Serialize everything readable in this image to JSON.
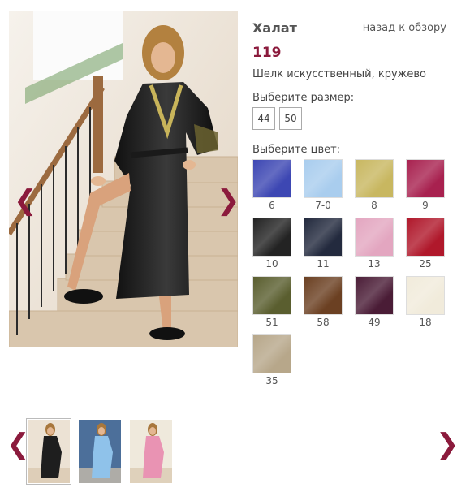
{
  "product": {
    "title": "Халат",
    "back_link": "назад к обзору",
    "price": "119",
    "material": "Шелк искусственный, кружево"
  },
  "sizes": {
    "label": "Выберите размер:",
    "options": [
      "44",
      "50"
    ]
  },
  "colors": {
    "label": "Выберите цвет:",
    "swatches": [
      {
        "code": "6",
        "color": "#3d47b3"
      },
      {
        "code": "7-0",
        "color": "#a9cdee"
      },
      {
        "code": "8",
        "color": "#c8b760"
      },
      {
        "code": "9",
        "color": "#a8214f"
      },
      {
        "code": "10",
        "color": "#232323"
      },
      {
        "code": "11",
        "color": "#232a3e"
      },
      {
        "code": "13",
        "color": "#e3a6c0"
      },
      {
        "code": "25",
        "color": "#b0182b"
      },
      {
        "code": "51",
        "color": "#5a5e2f"
      },
      {
        "code": "58",
        "color": "#6b4022"
      },
      {
        "code": "49",
        "color": "#4a1c36"
      },
      {
        "code": "18",
        "color": "#f1ebdb"
      },
      {
        "code": "35",
        "color": "#b7a78a"
      }
    ]
  },
  "navigation": {
    "prev_glyph": "❮",
    "next_glyph": "❯"
  },
  "thumbnails": [
    {
      "name": "thumb-black-robe",
      "robe_color": "#1e1e1e",
      "bg": "#ece2d4",
      "active": true
    },
    {
      "name": "thumb-blue-robe",
      "robe_color": "#8fc2ea",
      "bg": "#4c6f9a",
      "active": false
    },
    {
      "name": "thumb-pink-robe",
      "robe_color": "#e993b3",
      "bg": "#efe9dc",
      "active": false
    }
  ]
}
